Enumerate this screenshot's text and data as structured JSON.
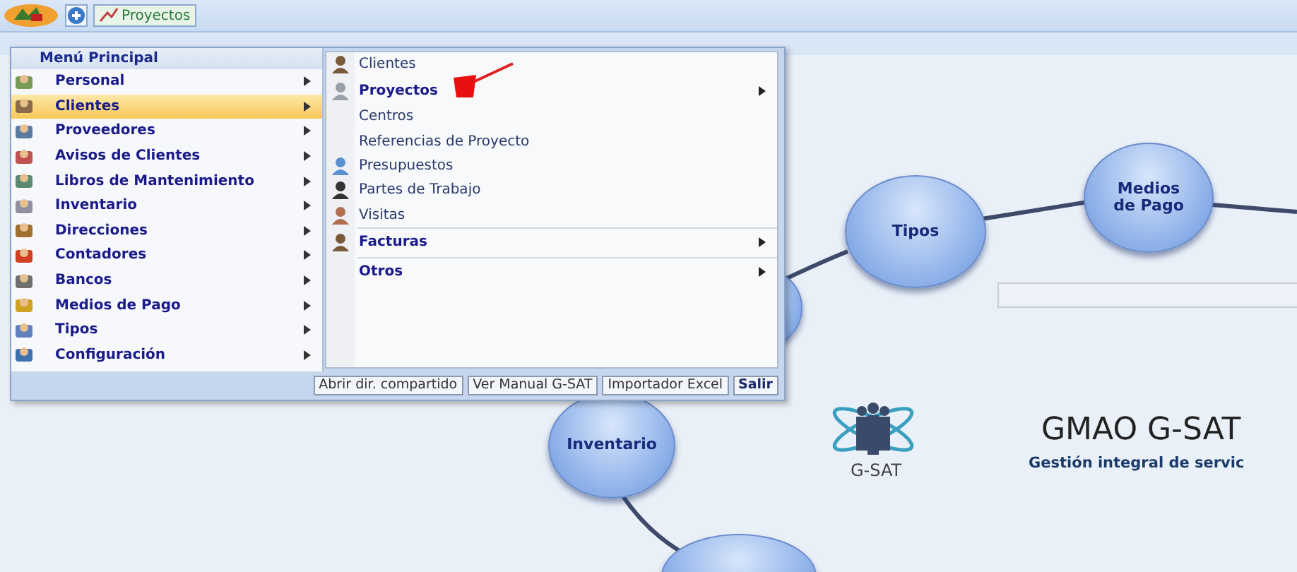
{
  "toolbar": {
    "tab": "Proyectos"
  },
  "menu": {
    "title": "Menú Principal",
    "items": [
      {
        "label": "Personal",
        "selected": false
      },
      {
        "label": "Clientes",
        "selected": true
      },
      {
        "label": "Proveedores",
        "selected": false
      },
      {
        "label": "Avisos de Clientes",
        "selected": false
      },
      {
        "label": "Libros de Mantenimiento",
        "selected": false
      },
      {
        "label": "Inventario",
        "selected": false
      },
      {
        "label": "Direcciones",
        "selected": false
      },
      {
        "label": "Contadores",
        "selected": false
      },
      {
        "label": "Bancos",
        "selected": false
      },
      {
        "label": "Medios de Pago",
        "selected": false
      },
      {
        "label": "Tipos",
        "selected": false
      },
      {
        "label": "Configuración",
        "selected": false
      }
    ],
    "submenu_groups": [
      [
        {
          "label": "Clientes",
          "kind": "item",
          "has_icon": true
        },
        {
          "label": "Proyectos",
          "kind": "submenu",
          "has_icon": true
        },
        {
          "label": "Centros",
          "kind": "item",
          "has_icon": false
        },
        {
          "label": "Referencias de Proyecto",
          "kind": "item",
          "has_icon": false
        },
        {
          "label": "Presupuestos",
          "kind": "item",
          "has_icon": true
        },
        {
          "label": "Partes de Trabajo",
          "kind": "item",
          "has_icon": true
        },
        {
          "label": "Visitas",
          "kind": "item",
          "has_icon": true
        }
      ],
      [
        {
          "label": "Facturas",
          "kind": "submenu",
          "has_icon": true
        }
      ],
      [
        {
          "label": "Otros",
          "kind": "submenu",
          "has_icon": false
        }
      ]
    ],
    "footer_buttons": [
      {
        "label": "Abrir dir. compartido",
        "kind": "normal"
      },
      {
        "label": "Ver Manual G-SAT",
        "kind": "normal"
      },
      {
        "label": "Importador Excel",
        "kind": "normal"
      },
      {
        "label": "Salir",
        "kind": "primary"
      }
    ]
  },
  "diagram": {
    "nodes": [
      {
        "label": "Tipos"
      },
      {
        "label": "Medios de Pago"
      },
      {
        "label": "Inventario"
      }
    ]
  },
  "brand": {
    "logo_text": "G-SAT",
    "title": "GMAO G-SAT",
    "subtitle": "Gestión integral de servic"
  }
}
